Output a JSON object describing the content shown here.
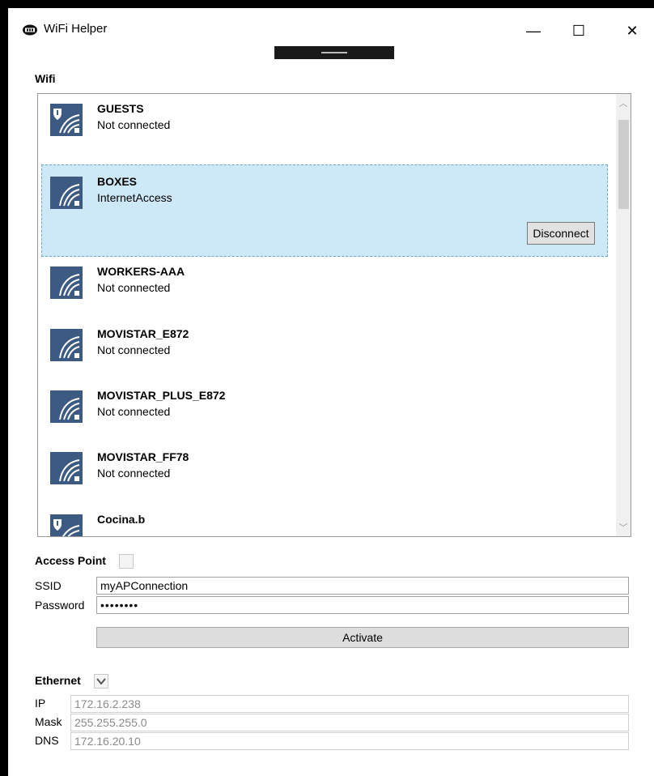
{
  "window": {
    "title": "WiFi Helper",
    "minimize": "—",
    "maximize": "☐",
    "close": "✕"
  },
  "wifi": {
    "section_label": "Wifi",
    "networks": [
      {
        "name": "GUESTS",
        "status": "Not connected",
        "icon": "secured-wifi-icon"
      },
      {
        "name": "BOXES",
        "status": "InternetAccess",
        "icon": "wifi-icon",
        "selected": true,
        "action_label": "Disconnect"
      },
      {
        "name": "WORKERS-AAA",
        "status": "Not connected",
        "icon": "wifi-icon"
      },
      {
        "name": "MOVISTAR_E872",
        "status": "Not connected",
        "icon": "wifi-icon"
      },
      {
        "name": "MOVISTAR_PLUS_E872",
        "status": "Not connected",
        "icon": "wifi-icon"
      },
      {
        "name": "MOVISTAR_FF78",
        "status": "Not connected",
        "icon": "wifi-icon"
      },
      {
        "name": "Cocina.b",
        "status": "",
        "icon": "secured-wifi-icon"
      }
    ]
  },
  "access_point": {
    "section_label": "Access Point",
    "enabled": false,
    "ssid_label": "SSID",
    "ssid_value": "myAPConnection",
    "password_label": "Password",
    "password_value": "••••••••",
    "activate_label": "Activate"
  },
  "ethernet": {
    "section_label": "Ethernet",
    "expanded": true,
    "ip_label": "IP",
    "ip_value": "172.16.2.238",
    "mask_label": "Mask",
    "mask_value": "255.255.255.0",
    "dns_label": "DNS",
    "dns_value": "172.16.20.10"
  },
  "colors": {
    "accent_blue": "#3c5a82",
    "selection_bg": "#cde8f6"
  }
}
